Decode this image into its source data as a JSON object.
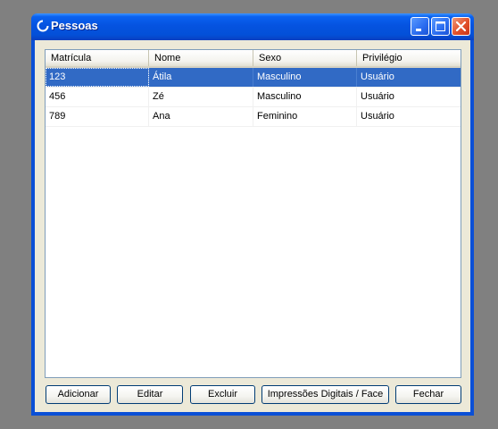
{
  "window": {
    "title": "Pessoas"
  },
  "listview": {
    "columns": [
      "Matrícula",
      "Nome",
      "Sexo",
      "Privilégio"
    ],
    "rows": [
      {
        "matricula": "123",
        "nome": "Átila",
        "sexo": "Masculino",
        "privilegio": "Usuário",
        "selected": true
      },
      {
        "matricula": "456",
        "nome": "Zé",
        "sexo": "Masculino",
        "privilegio": "Usuário",
        "selected": false
      },
      {
        "matricula": "789",
        "nome": "Ana",
        "sexo": "Feminino",
        "privilegio": "Usuário",
        "selected": false
      }
    ]
  },
  "buttons": {
    "add": "Adicionar",
    "edit": "Editar",
    "delete": "Excluir",
    "fingerprints": "Impressões Digitais / Face",
    "close": "Fechar"
  },
  "colors": {
    "titlebar": "#0553e0",
    "selection": "#316ac5",
    "face": "#ece9d8"
  },
  "icons": [
    "app-icon",
    "minimize-icon",
    "maximize-icon",
    "close-icon"
  ]
}
